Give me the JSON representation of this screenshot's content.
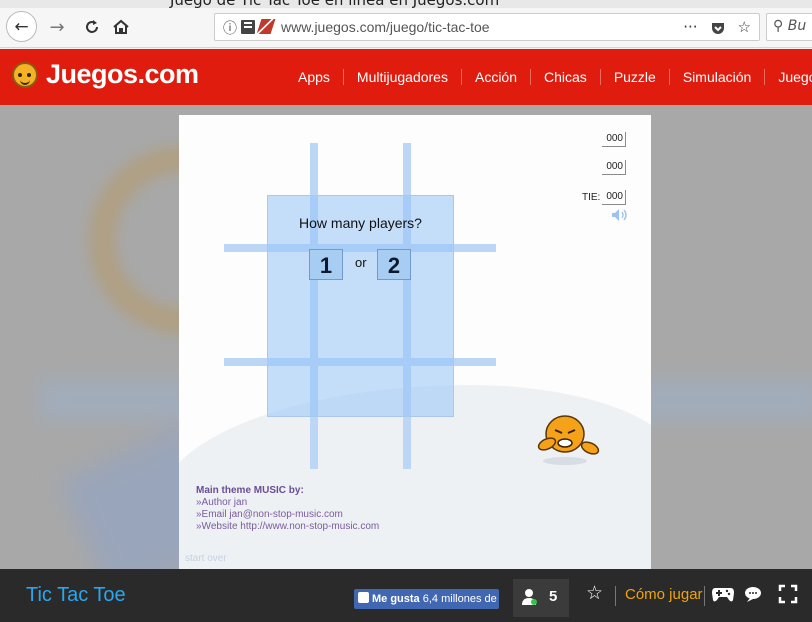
{
  "browser": {
    "title_fragment": "Juego de Tic Tac Toe en línea en Juegos.com",
    "url": "www.juegos.com/juego/tic-tac-toe",
    "search_placeholder": "Bu",
    "page_actions_icon": "ellipsis-icon",
    "pocket_icon": "pocket-icon",
    "bookmark_icon": "star-outline-icon"
  },
  "site": {
    "logo": "Juegos.com",
    "nav": [
      "Apps",
      "Multijugadores",
      "Acción",
      "Chicas",
      "Puzzle",
      "Simulación",
      "Juegos"
    ],
    "brand_color": "#e01c0f"
  },
  "game": {
    "prompt": "How many players?",
    "option_one": "1",
    "or_label": "or",
    "option_two": "2",
    "scores": {
      "x": "000",
      "o": "000",
      "tie_label": "TIE:",
      "tie": "000"
    },
    "credits": {
      "heading": "Main theme MUSIC by:",
      "author": "»Author   jan",
      "email": "»Email   jan@non-stop-music.com",
      "website": "»Website   http://www.non-stop-music.com"
    },
    "start_over": "start over"
  },
  "bottom_bar": {
    "title": "Tic Tac Toe",
    "like_label": "Me gusta",
    "like_count": "6,4 millones de",
    "players": "5",
    "how_to_play": "Cómo jugar"
  }
}
